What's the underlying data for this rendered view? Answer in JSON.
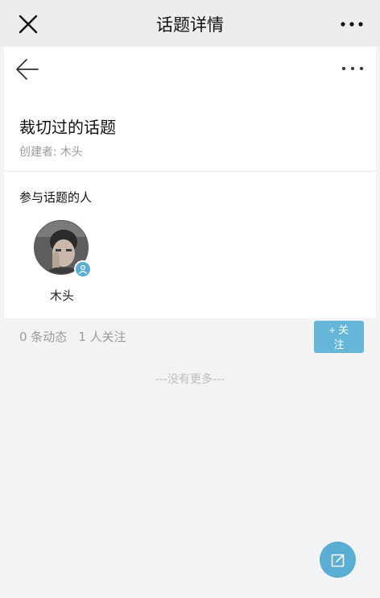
{
  "topbar": {
    "title": "话题详情",
    "close_icon": "close-icon",
    "more_icon": "more-horizontal-icon"
  },
  "card": {
    "back_icon": "arrow-left-icon",
    "more_icon": "more-horizontal-icon",
    "topic_title": "裁切过的话题",
    "creator_label": "创建者:",
    "creator_name": "木头",
    "participants_label": "参与话题的人",
    "participants": [
      {
        "name": "木头",
        "badge_icon": "user-icon"
      }
    ]
  },
  "stats": {
    "posts": "0 条动态",
    "followers": "1 人关注"
  },
  "follow_button": {
    "line1": "+ 关",
    "line2": "注"
  },
  "list_end": "---没有更多---",
  "fab": {
    "icon": "edit-icon"
  },
  "colors": {
    "accent": "#5aaed3",
    "button": "#66b6da",
    "muted_text": "#9a9a9a"
  }
}
